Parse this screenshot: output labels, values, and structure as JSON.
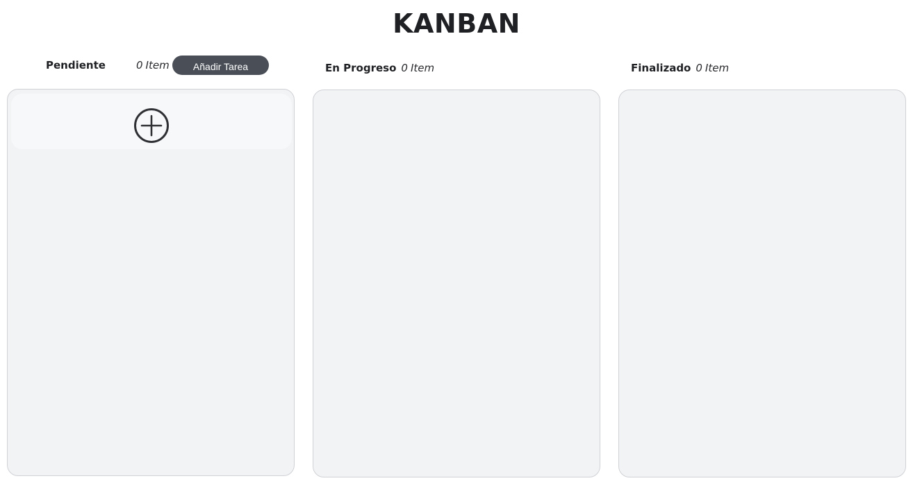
{
  "page": {
    "title": "KANBAN"
  },
  "columns": [
    {
      "name": "Pendiente",
      "count": "0",
      "count_label": "Item",
      "add_button_label": "Añadir Tarea"
    },
    {
      "name": "En Progreso",
      "count": "0",
      "count_label": "Item"
    },
    {
      "name": "Finalizado",
      "count": "0",
      "count_label": "Item"
    }
  ],
  "add_card": {
    "icon": "plus-circle-icon"
  },
  "colors": {
    "panel_background": "#f2f3f5",
    "panel_border": "#cfd1d5",
    "button_background": "#4a4f57",
    "button_text": "#ffffff",
    "title_text": "#1f2023"
  }
}
